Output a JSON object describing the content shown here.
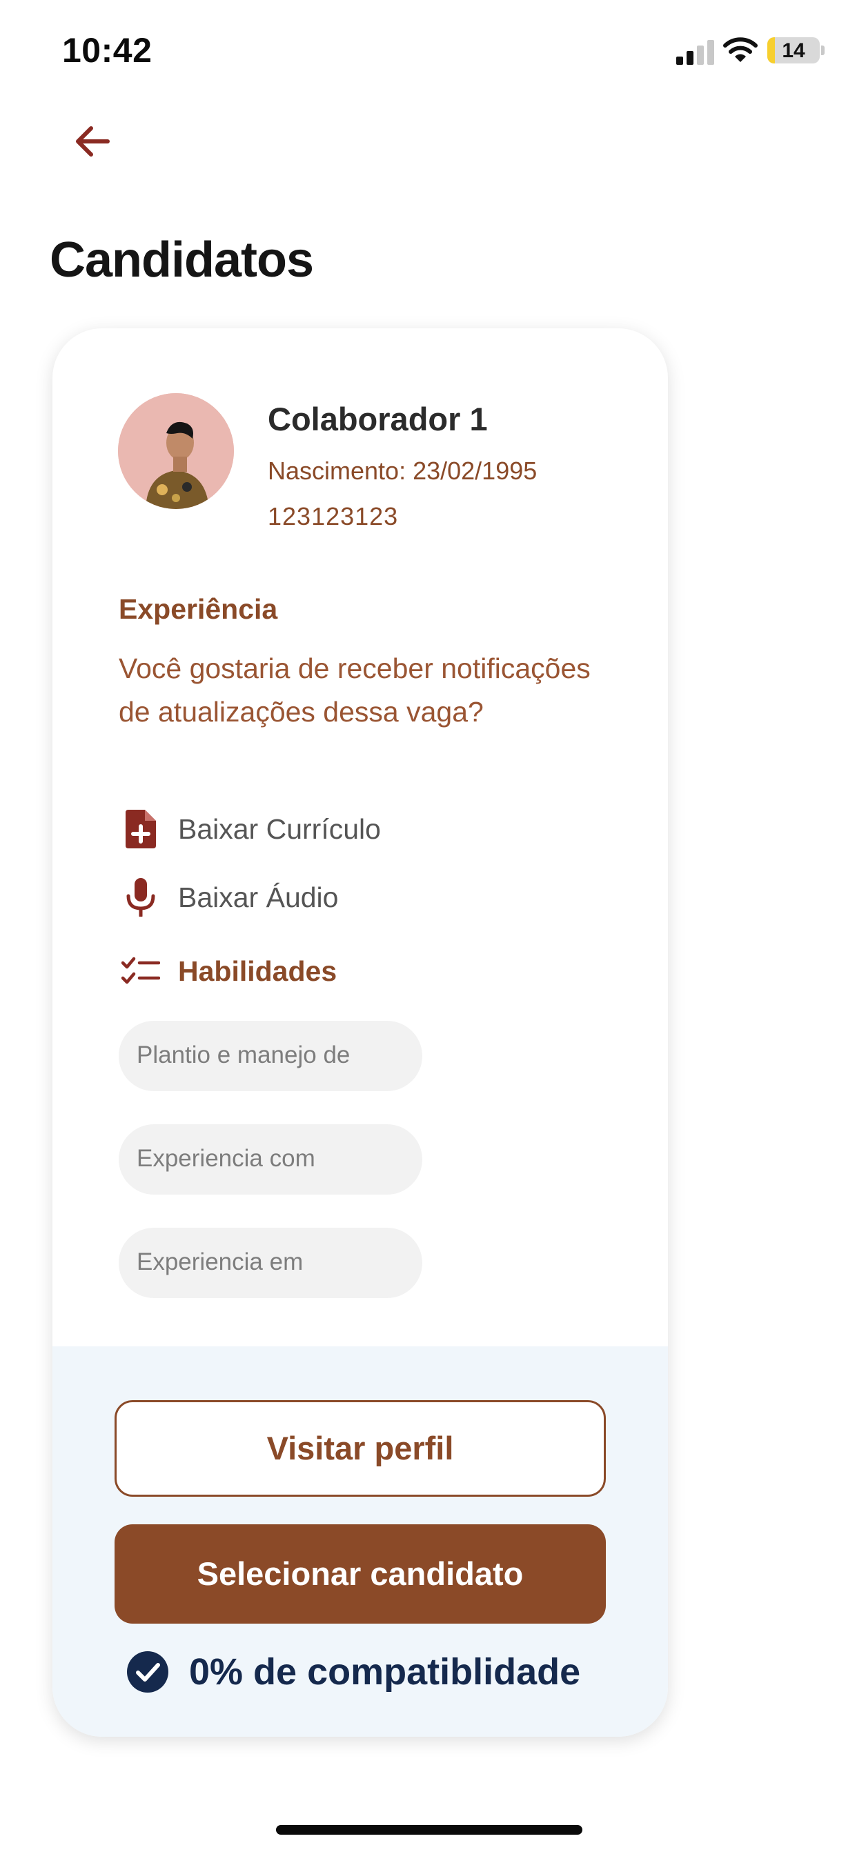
{
  "status_bar": {
    "time": "10:42",
    "battery_level": "14"
  },
  "header": {
    "title": "Candidatos"
  },
  "candidate": {
    "name": "Colaborador 1",
    "birth": "Nascimento: 23/02/1995",
    "phone": "123123123",
    "experience_title": "Experiência",
    "experience_text": "Você gostaria de receber notificações de atualizações dessa vaga?",
    "download_resume": "Baixar Currículo",
    "download_audio": "Baixar Áudio",
    "skills_title": "Habilidades",
    "skills": [
      "Plantio e manejo de",
      "Experiencia com",
      "Experiencia em"
    ]
  },
  "actions": {
    "visit_profile": "Visitar perfil",
    "select_candidate": "Selecionar candidato",
    "compatibility": "0% de compatiblidade"
  },
  "colors": {
    "accent": "#8a4a28",
    "accent_button": "#8b4a28",
    "navy": "#15294d",
    "footer_bg": "#f0f6fb"
  }
}
